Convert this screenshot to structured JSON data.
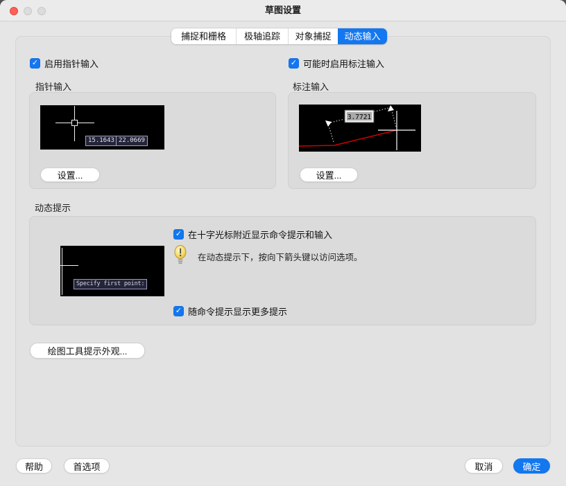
{
  "window": {
    "title": "草图设置"
  },
  "colors": {
    "accent": "#1377f0",
    "preview_bg": "#000000",
    "tooltip_bg": "#24243a",
    "red_line": "#d40000"
  },
  "tabs": [
    {
      "label": "捕捉和栅格",
      "active": false
    },
    {
      "label": "极轴追踪",
      "active": false
    },
    {
      "label": "对象捕捉",
      "active": false
    },
    {
      "label": "动态输入",
      "active": true
    }
  ],
  "pointer_input": {
    "enable_label": "启用指针输入",
    "enabled": true,
    "section_label": "指针输入",
    "coord_x": "15.1643",
    "coord_y": "22.0669",
    "settings_label": "设置..."
  },
  "dim_input": {
    "enable_label": "可能时启用标注输入",
    "enabled": true,
    "section_label": "标注输入",
    "value": "3.7721",
    "settings_label": "设置..."
  },
  "dynamic_prompts": {
    "section_label": "动态提示",
    "show_prompts_label": "在十字光标附近显示命令提示和输入",
    "show_prompts_checked": true,
    "tip_text": "在动态提示下，按向下箭头键以访问选项。",
    "more_tips_label": "随命令提示显示更多提示",
    "more_tips_checked": true,
    "preview_prompt": "Specify first point:"
  },
  "buttons": {
    "tooltip_appearance": "绘图工具提示外观...",
    "help": "帮助",
    "preferences": "首选项",
    "cancel": "取消",
    "ok": "确定"
  }
}
